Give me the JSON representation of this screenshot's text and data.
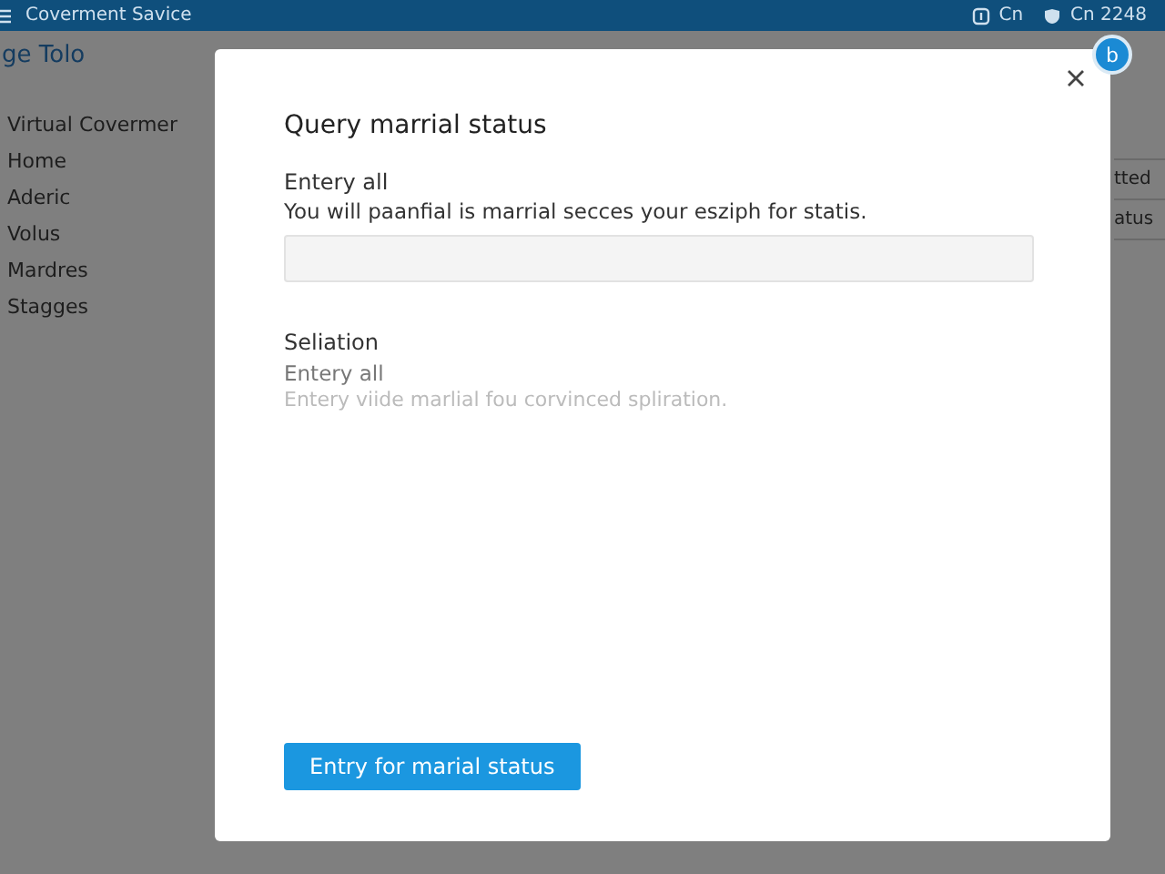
{
  "top_bar": {
    "title": "Coverment Savice",
    "status_1": "Cn",
    "status_2": "Cn 2248"
  },
  "page": {
    "title": "ge Tolo",
    "sidebar": {
      "heading": "Virtual Covermer",
      "items": [
        {
          "label": "Home"
        },
        {
          "label": "Aderic"
        },
        {
          "label": "Volus"
        },
        {
          "label": "Mardres"
        },
        {
          "label": "Stagges"
        }
      ]
    },
    "right_column": [
      "tted",
      "atus"
    ]
  },
  "badge": "b",
  "modal": {
    "title": "Query marrial status",
    "sections": [
      {
        "label": "Entery all",
        "description": "You will paanfial is marrial secces your esziph for statis.",
        "kind": "field"
      },
      {
        "label": "Seliation",
        "description": "Entery all",
        "note": "Entery viide marlial fou corvinced spliration.",
        "kind": "text"
      }
    ],
    "button": "Entry for marial status"
  }
}
